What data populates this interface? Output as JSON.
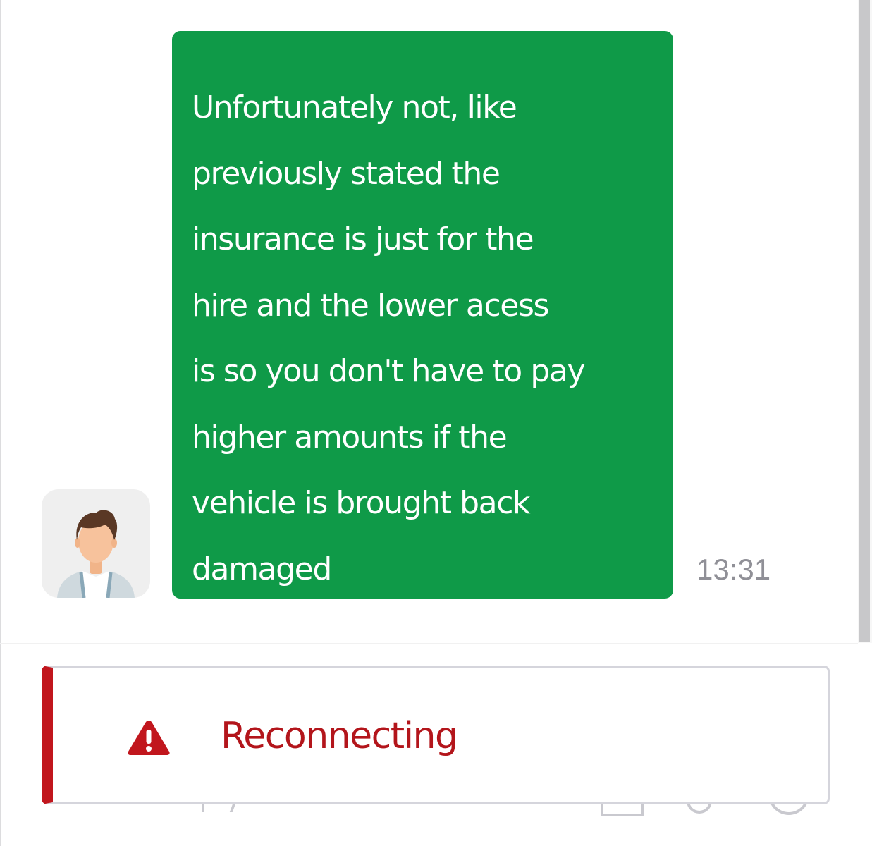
{
  "chat": {
    "messages": [
      {
        "lines": [
          "Unfortunately not, like",
          "previously stated the",
          "insurance is just for the",
          "hire and the lower acess",
          "is so you don't have to pay",
          "higher amounts if the",
          "vehicle is brought back",
          "damaged"
        ],
        "time": "13:31",
        "avatar_icon": "person-avatar-icon",
        "bubble_color": "#0f9a48"
      }
    ]
  },
  "status_banner": {
    "text": "Reconnecting",
    "icon": "warning-icon",
    "accent_color": "#c1161d"
  }
}
